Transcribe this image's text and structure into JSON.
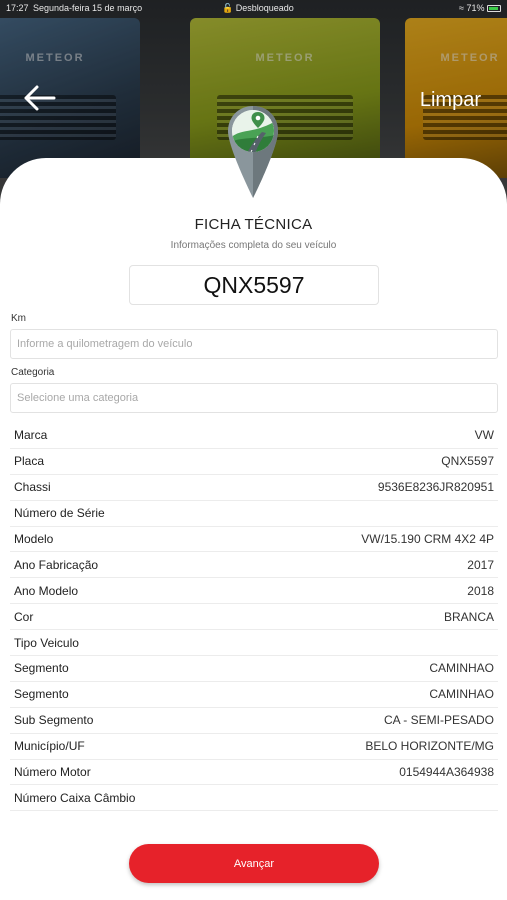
{
  "status_bar": {
    "time": "17:27",
    "date": "Segunda-feira 15 de março",
    "lock_text": "Desbloqueado",
    "battery": "71%"
  },
  "header": {
    "back_icon": "arrow-left-icon",
    "clear_label": "Limpar",
    "truck_brand": "METEOR"
  },
  "card": {
    "logo_icon": "map-pin-road-icon",
    "title": "FICHA TÉCNICA",
    "subtitle": "Informações completa do seu veículo",
    "plate": "QNX5597"
  },
  "form": {
    "km_label": "Km",
    "km_placeholder": "Informe a quilometragem do veículo",
    "category_label": "Categoria",
    "category_placeholder": "Selecione uma categoria"
  },
  "specs": [
    {
      "label": "Marca",
      "value": "VW"
    },
    {
      "label": "Placa",
      "value": "QNX5597"
    },
    {
      "label": "Chassi",
      "value": "9536E8236JR820951"
    },
    {
      "label": "Número de Série",
      "value": ""
    },
    {
      "label": "Modelo",
      "value": "VW/15.190 CRM 4X2 4P"
    },
    {
      "label": "Ano Fabricação",
      "value": "2017"
    },
    {
      "label": "Ano Modelo",
      "value": "2018"
    },
    {
      "label": "Cor",
      "value": "BRANCA"
    },
    {
      "label": "Tipo Veiculo",
      "value": ""
    },
    {
      "label": "Segmento",
      "value": "CAMINHAO"
    },
    {
      "label": "Segmento",
      "value": "CAMINHAO"
    },
    {
      "label": "Sub Segmento",
      "value": "CA - SEMI-PESADO"
    },
    {
      "label": "Município/UF",
      "value": "BELO HORIZONTE/MG"
    },
    {
      "label": "Número Motor",
      "value": "0154944A364938"
    },
    {
      "label": "Número Caixa Câmbio",
      "value": ""
    }
  ],
  "footer": {
    "next_label": "Avançar"
  },
  "colors": {
    "accent": "#e6222a",
    "pin_green": "#3f8f4a",
    "pin_gray": "#7d8a90"
  }
}
